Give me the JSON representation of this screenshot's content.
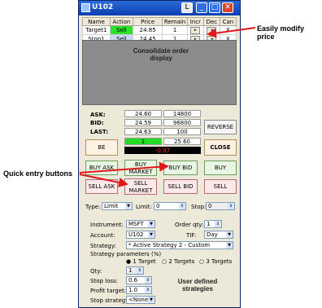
{
  "window": {
    "title": "U102",
    "title_buttons": [
      "L",
      "_",
      "□",
      "✕"
    ]
  },
  "grid": {
    "headers": [
      "Name",
      "Action",
      "Price",
      "Remain",
      "Incr",
      "Dec",
      "Can"
    ],
    "rows": [
      {
        "name": "Target1",
        "action": "Sell",
        "price": "24.85",
        "remain": "1",
        "incr": "▸",
        "dec": "◂",
        "can": "X"
      },
      {
        "name": "Stop1",
        "action": "Sell",
        "price": "24.45",
        "remain": "1",
        "incr": "▸",
        "dec": "◂",
        "can": "X"
      }
    ]
  },
  "display": {
    "label": "Consolidate order display"
  },
  "quotes": {
    "ask_label": "ASK:",
    "ask_price": "24.60",
    "ask_size": "14800",
    "bid_label": "BID:",
    "bid_price": "24.59",
    "bid_size": "96800",
    "last_label": "LAST:",
    "last_price": "24.63",
    "last_size": "100",
    "position": "1",
    "position_price": "25.60",
    "pnl": "-0.97"
  },
  "buttons": {
    "reverse": "REVERSE",
    "be": "BE",
    "close": "CLOSE",
    "buy_ask": "BUY ASK",
    "buy_market": "BUY MARKET",
    "buy_bid": "BUY BID",
    "buy": "BUY",
    "sell_ask": "SELL ASK",
    "sell_market": "SELL MARKET",
    "sell_bid": "SELL BID",
    "sell": "SELL"
  },
  "order_type": {
    "type_label": "Type:",
    "type_value": "Limit",
    "limit_label": "Limit:",
    "limit_value": "0",
    "stop_label": "Stop:",
    "stop_value": "0"
  },
  "settings": {
    "instrument_label": "Instrument:",
    "instrument_value": "MSFT",
    "order_qty_label": "Order qty:",
    "order_qty_value": "1",
    "account_label": "Account:",
    "account_value": "U102",
    "tif_label": "TIF:",
    "tif_value": "Day",
    "strategy_label": "Strategy:",
    "strategy_value": "* Active Strategy 2 - Custom",
    "params_label": "Strategy parameters (%)",
    "radio_1": "1 Target",
    "radio_2": "2 Targets",
    "radio_3": "3 Targets",
    "qty_label": "Qty:",
    "qty_value": "1",
    "stop_loss_label": "Stop loss:",
    "stop_loss_value": "0.6",
    "profit_target_label": "Profit target:",
    "profit_target_value": "1.0",
    "stop_strategy_label": "Stop strategy:",
    "stop_strategy_value": "<None>"
  },
  "annotations": {
    "modify_price": "Easily modify price",
    "quick_entry": "Quick entry buttons",
    "user_strategies": "User defined strategies"
  },
  "colors": {
    "titlebar": "#0a3fb0",
    "sell_cell": "#2ee02e",
    "position_green": "#22dd22",
    "pnl_bg": "#000000",
    "pnl_text": "#ff2a2a",
    "arrow_red": "#e01818"
  }
}
